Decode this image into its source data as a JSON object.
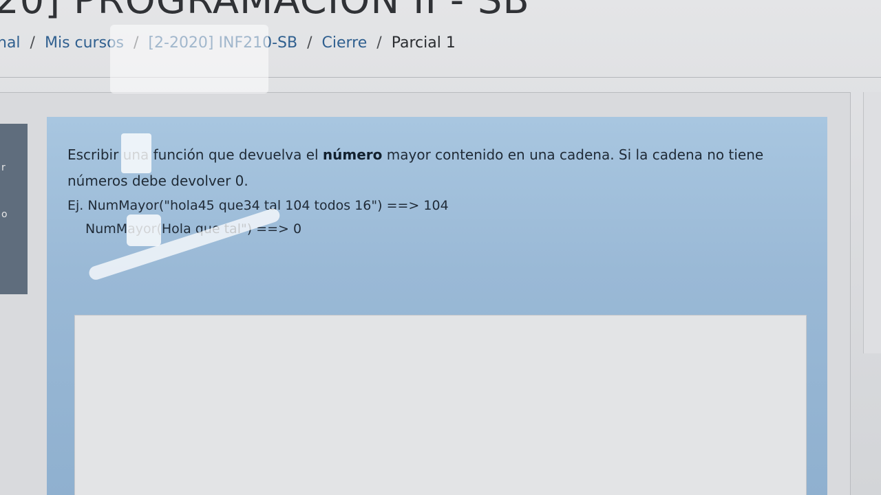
{
  "header": {
    "course_title": "20] PROGRAMACION II - SB"
  },
  "breadcrumb": {
    "items": [
      {
        "label": "nal"
      },
      {
        "label": "Mis cursos"
      },
      {
        "label": "[2-2020] INF210-SB"
      },
      {
        "label": "Cierre"
      },
      {
        "label": "Parcial 1"
      }
    ],
    "separator": "/"
  },
  "left_panel": {
    "text_1": "r",
    "text_2": "o"
  },
  "question": {
    "text_before": "Escribir una función que devuelva el ",
    "text_bold": "número",
    "text_after": " mayor contenido en una cadena. Si la cadena no tiene números debe devolver 0.",
    "example_line_1": "Ej. NumMayor(\"hola45 que34 tal 104 todos 16\") ==> 104",
    "example_line_2": "NumMayor(Hola que tal\") ==> 0"
  },
  "answer": {
    "value": ""
  }
}
